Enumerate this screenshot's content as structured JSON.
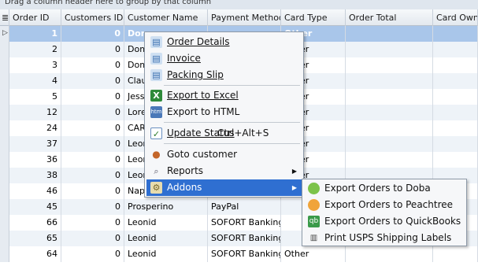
{
  "group_hint": "Drag a column header here to group by that column",
  "columns": [
    "Order ID",
    "Customers ID",
    "Customer Name",
    "Payment Method",
    "Card Type",
    "Order Total",
    "Card Owner"
  ],
  "rows": [
    {
      "order_id": "1",
      "customer_id": "0",
      "name": "Dome",
      "payment": "",
      "card": "Other",
      "selected": true
    },
    {
      "order_id": "2",
      "customer_id": "0",
      "name": "Dome",
      "payment": "",
      "card": "Other"
    },
    {
      "order_id": "3",
      "customer_id": "0",
      "name": "Dome",
      "payment": "",
      "card": "Other"
    },
    {
      "order_id": "4",
      "customer_id": "0",
      "name": "Claud",
      "payment": "",
      "card": "Other"
    },
    {
      "order_id": "5",
      "customer_id": "0",
      "name": "Jessi",
      "payment": "",
      "card": "Other"
    },
    {
      "order_id": "12",
      "customer_id": "0",
      "name": "Loren",
      "payment": "",
      "card": "Other"
    },
    {
      "order_id": "24",
      "customer_id": "0",
      "name": "CART",
      "payment": "",
      "card": "Other"
    },
    {
      "order_id": "37",
      "customer_id": "0",
      "name": "Leon",
      "payment": "",
      "card": "Other"
    },
    {
      "order_id": "36",
      "customer_id": "0",
      "name": "Leon",
      "payment": "",
      "card": "Other"
    },
    {
      "order_id": "38",
      "customer_id": "0",
      "name": "Leon",
      "payment": "",
      "card": "Other"
    },
    {
      "order_id": "46",
      "customer_id": "0",
      "name": "Napo",
      "payment": "",
      "card": "Other"
    },
    {
      "order_id": "45",
      "customer_id": "0",
      "name": "Prosperino",
      "payment": "PayPal",
      "card": ""
    },
    {
      "order_id": "66",
      "customer_id": "0",
      "name": "Leonid",
      "payment": "SOFORT Banking",
      "card": ""
    },
    {
      "order_id": "65",
      "customer_id": "0",
      "name": "Leonid",
      "payment": "SOFORT Banking",
      "card": ""
    },
    {
      "order_id": "64",
      "customer_id": "0",
      "name": "Leonid",
      "payment": "SOFORT Banking",
      "card": "Other"
    }
  ],
  "context_menu": {
    "order_details": "Order Details",
    "invoice": "Invoice",
    "packing_slip": "Packing Slip",
    "export_excel": "Export to Excel",
    "export_html": "Export to HTML",
    "update_status": "Update Status",
    "update_status_shortcut": "Ctrl+Alt+S",
    "goto_customer": "Goto customer",
    "reports": "Reports",
    "addons": "Addons"
  },
  "submenu": {
    "doba": "Export Orders to Doba",
    "peachtree": "Export Orders to Peachtree",
    "quickbooks": "Export Orders to QuickBooks",
    "usps": "Print USPS Shipping Labels"
  },
  "icons": {
    "order_details": "document-icon",
    "invoice": "document-icon",
    "packing_slip": "document-icon",
    "export_excel": "excel-icon",
    "export_html": "html-icon",
    "update_status": "checkbox-icon",
    "goto_customer": "user-icon",
    "reports": "magnifier-icon",
    "addons": "addons-icon",
    "doba": "doba-icon",
    "peachtree": "peachtree-icon",
    "quickbooks": "quickbooks-icon",
    "usps": "barcode-icon"
  },
  "colors": {
    "selected_row": "#a9c6ea",
    "menu_highlight": "#2f6fd1",
    "alt_row": "#eef3f8"
  }
}
